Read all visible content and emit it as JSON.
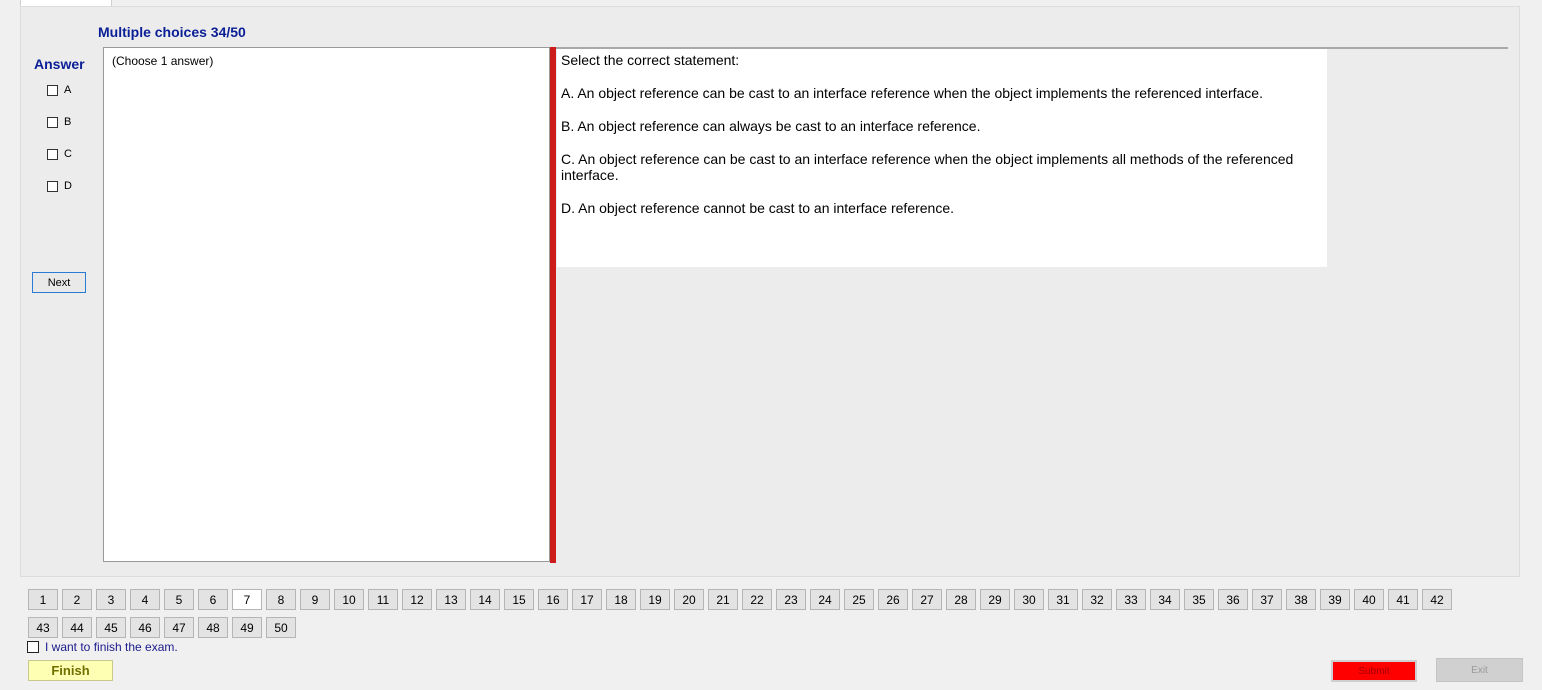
{
  "header": {
    "title": "Multiple choices 34/50"
  },
  "answer": {
    "label": "Answer",
    "options": [
      "A",
      "B",
      "C",
      "D"
    ],
    "next_label": "Next",
    "box_text": "(Choose 1 answer)"
  },
  "question": {
    "prompt": "Select the correct statement:",
    "choices": [
      "A.  An object reference can be cast to an interface reference when the object implements the referenced interface.",
      "B.  An object reference can always be cast to an interface reference.",
      "C.  An object reference can be cast to an interface reference when the object implements all methods of the referenced interface.",
      "D.  An object reference cannot be cast to an interface reference."
    ]
  },
  "navigation": {
    "current": "7",
    "numbers": [
      "1",
      "2",
      "3",
      "4",
      "5",
      "6",
      "7",
      "8",
      "9",
      "10",
      "11",
      "12",
      "13",
      "14",
      "15",
      "16",
      "17",
      "18",
      "19",
      "20",
      "21",
      "22",
      "23",
      "24",
      "25",
      "26",
      "27",
      "28",
      "29",
      "30",
      "31",
      "32",
      "33",
      "34",
      "35",
      "36",
      "37",
      "38",
      "39",
      "40",
      "41",
      "42",
      "43",
      "44",
      "45",
      "46",
      "47",
      "48",
      "49",
      "50"
    ]
  },
  "footer": {
    "finish_check_label": "I want to finish the exam.",
    "finish_label": "Finish",
    "submit_label": "Submit",
    "exit_label": "Exit"
  },
  "colors": {
    "title": "#0a1e96",
    "splitter": "#cc1c1c",
    "finish_bg": "#ffffb4",
    "submit_bg": "#ff0000"
  }
}
